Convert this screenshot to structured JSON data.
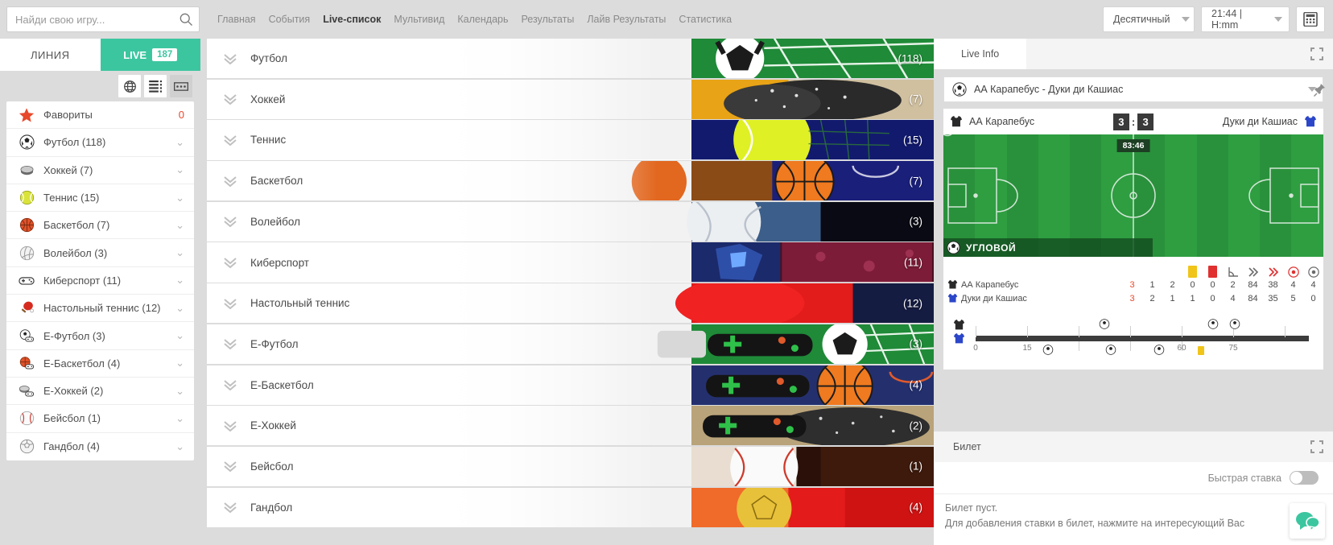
{
  "search": {
    "placeholder": "Найди свою игру...",
    "value": "",
    "icon": "search-icon"
  },
  "mainnav": {
    "items": [
      {
        "label": "Главная",
        "active": false
      },
      {
        "label": "События",
        "active": false
      },
      {
        "label": "Live-список",
        "active": true
      },
      {
        "label": "Мультивид",
        "active": false
      },
      {
        "label": "Календарь",
        "active": false
      },
      {
        "label": "Результаты",
        "active": false
      },
      {
        "label": "Лайв Результаты",
        "active": false
      },
      {
        "label": "Статистика",
        "active": false
      }
    ]
  },
  "topright": {
    "odds_format": "Десятичный",
    "time_format": "21:44 | H:mm",
    "calculator_icon": "calculator-icon"
  },
  "sidebar": {
    "tab_line": "ЛИНИЯ",
    "tab_live": "LIVE",
    "live_count": "187",
    "view_buttons": [
      "globe-icon",
      "list-icon",
      "coupon-icon"
    ],
    "favorites": {
      "label": "Фавориты",
      "count": "0",
      "icon": "star-icon"
    },
    "items": [
      {
        "label": "Футбол (118)",
        "icon": "soccer-ball-icon"
      },
      {
        "label": "Хоккей (7)",
        "icon": "hockey-puck-icon"
      },
      {
        "label": "Теннис (15)",
        "icon": "tennis-ball-icon"
      },
      {
        "label": "Баскетбол (7)",
        "icon": "basketball-icon"
      },
      {
        "label": "Волейбол (3)",
        "icon": "volleyball-icon"
      },
      {
        "label": "Киберспорт (11)",
        "icon": "gamepad-icon"
      },
      {
        "label": "Настольный теннис (12)",
        "icon": "table-tennis-icon"
      },
      {
        "label": "Е-Футбол (3)",
        "icon": "e-soccer-icon"
      },
      {
        "label": "Е-Баскетбол (4)",
        "icon": "e-basketball-icon"
      },
      {
        "label": "Е-Хоккей (2)",
        "icon": "e-hockey-icon"
      },
      {
        "label": "Бейсбол (1)",
        "icon": "baseball-icon"
      },
      {
        "label": "Гандбол (4)",
        "icon": "handball-icon"
      }
    ]
  },
  "center": {
    "rows": [
      {
        "label": "Футбол",
        "count": "(118)",
        "art": "soccer"
      },
      {
        "label": "Хоккей",
        "count": "(7)",
        "art": "hockey"
      },
      {
        "label": "Теннис",
        "count": "(15)",
        "art": "tennis"
      },
      {
        "label": "Баскетбол",
        "count": "(7)",
        "art": "basket"
      },
      {
        "label": "Волейбол",
        "count": "(3)",
        "art": "volley"
      },
      {
        "label": "Киберспорт",
        "count": "(11)",
        "art": "esport"
      },
      {
        "label": "Настольный теннис",
        "count": "(12)",
        "art": "ttennis"
      },
      {
        "label": "Е-Футбол",
        "count": "(3)",
        "art": "esoccer"
      },
      {
        "label": "Е-Баскетбол",
        "count": "(4)",
        "art": "ebasket"
      },
      {
        "label": "Е-Хоккей",
        "count": "(2)",
        "art": "ehockey"
      },
      {
        "label": "Бейсбол",
        "count": "(1)",
        "art": "baseball"
      },
      {
        "label": "Гандбол",
        "count": "(4)",
        "art": "handball"
      }
    ]
  },
  "live_info": {
    "tab_label": "Live Info",
    "expand_icon": "expand-icon",
    "match_select": "АА Карапебус - Дуки ди Кашиас",
    "pin_icon": "pin-icon",
    "home_team": "АА Карапебус",
    "away_team": "Дуки ди Кашиас",
    "home_score": "3",
    "away_score": "3",
    "score_sep": ":",
    "clock": "83:46",
    "event_text": "УГЛОВОЙ",
    "stats_columns": [
      "goal",
      "yellow-card-icon",
      "red-card-icon",
      "corner-icon",
      "attack-icon",
      "dangerous-attack-icon",
      "possession-icon",
      "shots-icon"
    ],
    "stats": [
      {
        "team": "АА Карапебус",
        "icon": "shirt-dark-icon",
        "values": [
          "3",
          "1",
          "2",
          "0",
          "0",
          "2",
          "84",
          "38",
          "4",
          "4"
        ]
      },
      {
        "team": "Дуки ди Кашиас",
        "icon": "shirt-blue-icon",
        "values": [
          "3",
          "2",
          "1",
          "1",
          "0",
          "4",
          "84",
          "35",
          "5",
          "0"
        ]
      }
    ],
    "timeline": {
      "ticks": [
        "0",
        "15",
        "",
        "",
        "60",
        "75",
        ""
      ],
      "tick_values": [
        0,
        15,
        30,
        45,
        60,
        75,
        90
      ],
      "events": [
        {
          "minute": 37,
          "type": "goal",
          "side": "top"
        },
        {
          "minute": 68,
          "type": "goal",
          "side": "top"
        },
        {
          "minute": 74,
          "type": "goal",
          "side": "top"
        },
        {
          "minute": 21,
          "type": "goal",
          "side": "bottom"
        },
        {
          "minute": 40,
          "type": "goal",
          "side": "bottom"
        },
        {
          "minute": 55,
          "type": "goal",
          "side": "bottom"
        },
        {
          "minute": 64,
          "type": "yellow",
          "side": "bottom"
        }
      ]
    }
  },
  "ticket": {
    "tab_label": "Билет",
    "expand_icon": "expand-icon",
    "quick_bet_label": "Быстрая ставка",
    "empty_title": "Билет пуст.",
    "empty_hint": "Для добавления ставки в билет, нажмите на интересующий Вас",
    "chat_icon": "chat-icon"
  }
}
